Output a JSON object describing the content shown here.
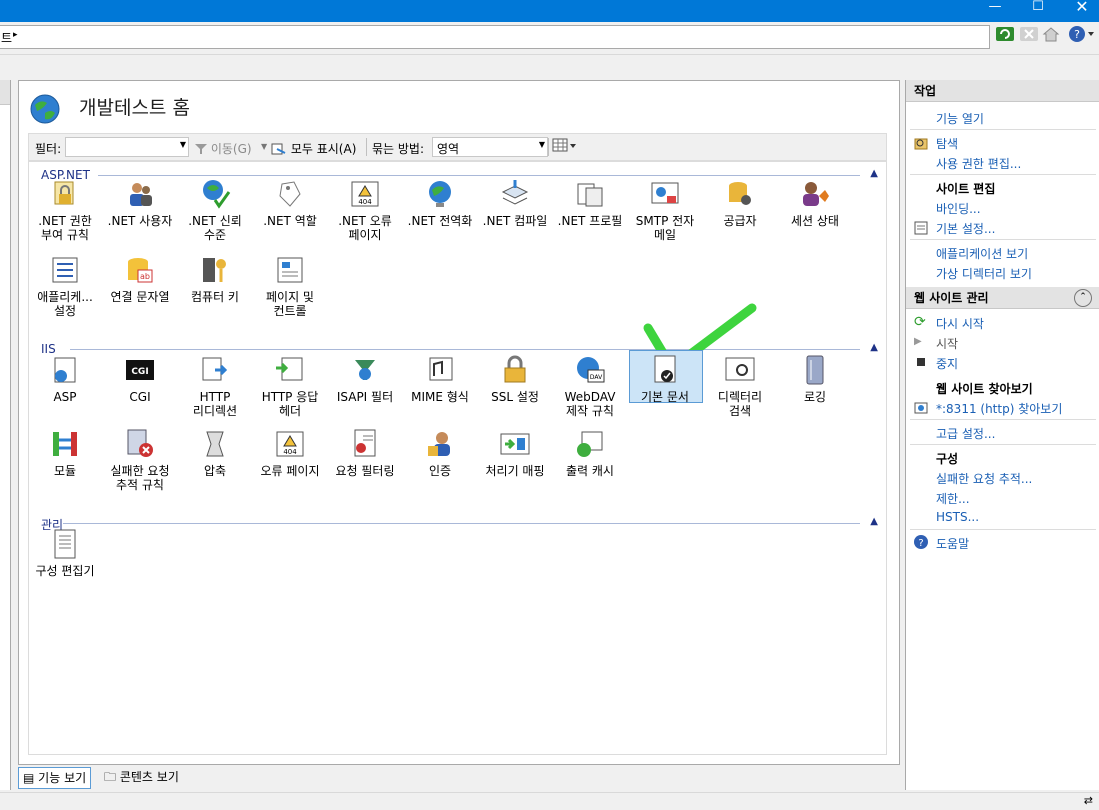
{
  "address": {
    "text": "트",
    "arrow": "▸"
  },
  "header": {
    "title": "개발테스트 홈"
  },
  "filterbar": {
    "filter_label": "필터:",
    "filter_value": "",
    "goto_label": "이동(G)",
    "showall_label": "모두 표시(A)",
    "groupby_label": "묶는 방법:",
    "groupby_value": "영역"
  },
  "groups": [
    {
      "name": "ASP.NET",
      "items": [
        {
          "label": ".NET 권한\n부여 규칙",
          "icon": "lock-user-icon"
        },
        {
          "label": ".NET 사용자",
          "icon": "users-icon"
        },
        {
          "label": ".NET 신뢰\n수준",
          "icon": "trust-globe-icon"
        },
        {
          "label": ".NET 역할",
          "icon": "tags-icon"
        },
        {
          "label": ".NET 오류\n페이지",
          "icon": "error-404-icon"
        },
        {
          "label": ".NET 전역화",
          "icon": "globe-icon"
        },
        {
          "label": ".NET 컴파일",
          "icon": "compile-icon"
        },
        {
          "label": ".NET 프로필",
          "icon": "profile-icon"
        },
        {
          "label": "SMTP 전자\n메일",
          "icon": "email-icon"
        },
        {
          "label": "공급자",
          "icon": "providers-icon"
        },
        {
          "label": "세션 상태",
          "icon": "session-icon"
        },
        {
          "label": "애플리케...\n설정",
          "icon": "app-settings-icon"
        },
        {
          "label": "연결 문자열",
          "icon": "db-string-icon"
        },
        {
          "label": "컴퓨터 키",
          "icon": "machine-key-icon"
        },
        {
          "label": "페이지 및\n컨트롤",
          "icon": "pages-controls-icon"
        }
      ]
    },
    {
      "name": "IIS",
      "items": [
        {
          "label": "ASP",
          "icon": "asp-icon"
        },
        {
          "label": "CGI",
          "icon": "cgi-icon"
        },
        {
          "label": "HTTP\n리디렉션",
          "icon": "redirect-icon"
        },
        {
          "label": "HTTP 응답\n헤더",
          "icon": "response-header-icon"
        },
        {
          "label": "ISAPI 필터",
          "icon": "isapi-filter-icon"
        },
        {
          "label": "MIME 형식",
          "icon": "mime-icon"
        },
        {
          "label": "SSL 설정",
          "icon": "ssl-lock-icon"
        },
        {
          "label": "WebDAV\n제작 규칙",
          "icon": "webdav-icon"
        },
        {
          "label": "기본 문서",
          "icon": "default-doc-icon",
          "selected": true
        },
        {
          "label": "디렉터리\n검색",
          "icon": "dir-browse-icon"
        },
        {
          "label": "로깅",
          "icon": "logging-icon"
        },
        {
          "label": "모듈",
          "icon": "modules-icon"
        },
        {
          "label": "실패한 요청\n추적 규칙",
          "icon": "failed-trace-icon"
        },
        {
          "label": "압축",
          "icon": "compress-icon"
        },
        {
          "label": "오류 페이지",
          "icon": "error-page-icon"
        },
        {
          "label": "요청 필터링",
          "icon": "request-filter-icon"
        },
        {
          "label": "인증",
          "icon": "auth-icon"
        },
        {
          "label": "처리기 매핑",
          "icon": "handler-icon"
        },
        {
          "label": "출력 캐시",
          "icon": "output-cache-icon"
        }
      ]
    },
    {
      "name": "관리",
      "items": [
        {
          "label": "구성 편집기",
          "icon": "config-editor-icon"
        }
      ]
    }
  ],
  "bottom_tabs": {
    "features": "기능 보기",
    "content": "콘텐츠 보기"
  },
  "actions": {
    "header": "작업",
    "open_feature": "기능 열기",
    "explore": "탐색",
    "edit_perms": "사용 권한 편집...",
    "edit_site_title": "사이트 편집",
    "bindings": "바인딩...",
    "basic_settings": "기본 설정...",
    "view_apps": "애플리케이션 보기",
    "view_vdirs": "가상 디렉터리 보기",
    "manage_header": "웹 사이트 관리",
    "restart": "다시 시작",
    "start": "시작",
    "stop": "중지",
    "browse_title": "웹 사이트 찾아보기",
    "browse_link": "*:8311 (http) 찾아보기",
    "advanced": "고급 설정...",
    "config_title": "구성",
    "failed_trace": "실패한 요청 추적...",
    "limits": "제한...",
    "hsts": "HSTS...",
    "help": "도움말"
  },
  "colors": {
    "titlebar": "#0078d7",
    "link": "#1a5fb4",
    "check": "#3ed43e"
  }
}
